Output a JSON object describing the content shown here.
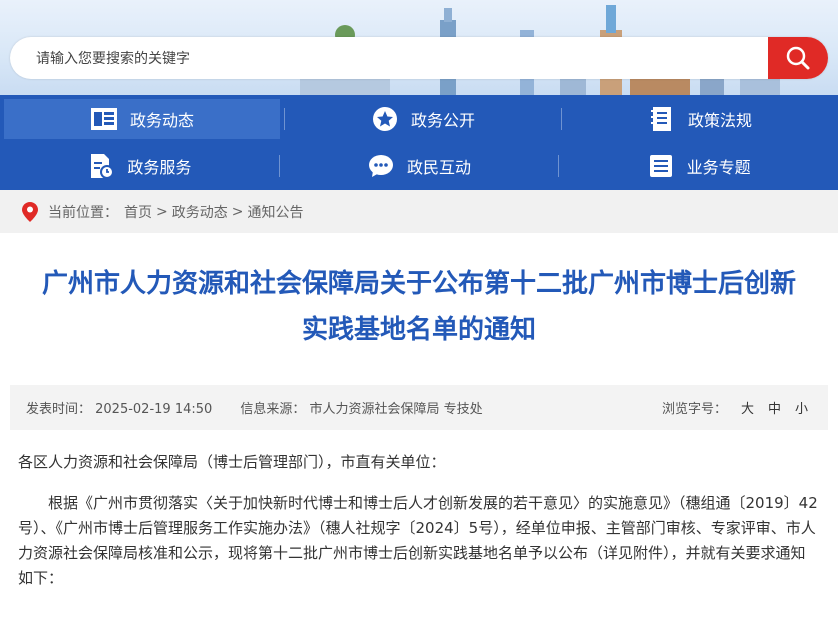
{
  "search": {
    "placeholder": "请输入您要搜索的关键字"
  },
  "nav": {
    "row1": [
      "政务动态",
      "政务公开",
      "政策法规"
    ],
    "row2": [
      "政务服务",
      "政民互动",
      "业务专题"
    ]
  },
  "breadcrumb": {
    "prefix": "当前位置：",
    "items": [
      "首页",
      "政务动态",
      "通知公告"
    ],
    "separator": ">"
  },
  "article": {
    "title_line1": "广州市人力资源和社会保障局关于公布第十二批广州市博士后创新",
    "title_line2": "实践基地名单的通知",
    "publish_time": "发表时间： 2025-02-19 14:50",
    "source": "信息来源： 市人力资源社会保障局 专技处",
    "font_size_label": "浏览字号：",
    "font_sizes": [
      "大",
      "中",
      "小"
    ],
    "salutation": "各区人力资源和社会保障局（博士后管理部门），市直有关单位：",
    "paragraph1": "根据《广州市贯彻落实〈关于加快新时代博士和博士后人才创新发展的若干意见〉的实施意见》（穗组通〔2019〕42号）、《广州市博士后管理服务工作实施办法》（穗人社规字〔2024〕5号），经单位申报、主管部门审核、专家评审、市人力资源社会保障局核准和公示，现将第十二批广州市博士后创新实践基地名单予以公布（详见附件），并就有关要求通知如下："
  },
  "colors": {
    "brand_blue": "#2359b8",
    "search_red": "#e02a26"
  }
}
